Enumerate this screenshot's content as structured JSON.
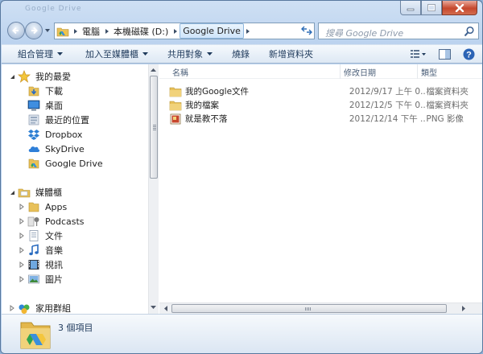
{
  "window": {
    "title": "Google Drive"
  },
  "address": {
    "crumbs": [
      "電腦",
      "本機磁碟 (D:)",
      "Google Drive"
    ],
    "search_placeholder": "搜尋 Google Drive"
  },
  "toolbar": {
    "organize": "組合管理",
    "add_to_library": "加入至媒體櫃",
    "share_with": "共用對象",
    "burn": "燒錄",
    "new_folder": "新增資料夾"
  },
  "nav": {
    "favorites": {
      "label": "我的最愛",
      "items": [
        "下載",
        "桌面",
        "最近的位置",
        "Dropbox",
        "SkyDrive",
        "Google Drive"
      ]
    },
    "libraries": {
      "label": "媒體櫃",
      "items": [
        "Apps",
        "Podcasts",
        "文件",
        "音樂",
        "視訊",
        "圖片"
      ]
    },
    "homegroup": {
      "label": "家用群組"
    }
  },
  "columns": {
    "name": "名稱",
    "date": "修改日期",
    "type": "類型"
  },
  "files": [
    {
      "name": "我的Google文件",
      "date": "2012/9/17 上午 0...",
      "type": "檔案資料夾",
      "icon": "folder-icon"
    },
    {
      "name": "我的檔案",
      "date": "2012/12/5 下午 0...",
      "type": "檔案資料夾",
      "icon": "folder-icon"
    },
    {
      "name": "就是教不落",
      "date": "2012/12/14 下午 ...",
      "type": "PNG 影像",
      "icon": "png-image-icon"
    }
  ],
  "status": {
    "item_count": "3 個項目"
  },
  "colors": {
    "window_frame": "#b9d1ee",
    "close_button": "#c5472d",
    "folder": "#e8c15a"
  }
}
